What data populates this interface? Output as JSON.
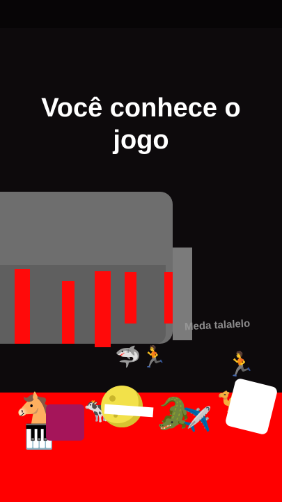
{
  "title": "Você conhece o jogo",
  "watermark": "Meda talalelo",
  "colors": {
    "background": "#0d0a0c",
    "floor": "#ff0000",
    "bars": "#ff0a0a",
    "tank": "#6e6e6e"
  },
  "sprites": {
    "shark_runner": "🦈🏃",
    "runner": "🏃",
    "horse": "🐴",
    "piano": "🎹",
    "cow": "🐄",
    "crocodile": "🐊",
    "airplane": "✈️",
    "camel": "🐪"
  }
}
